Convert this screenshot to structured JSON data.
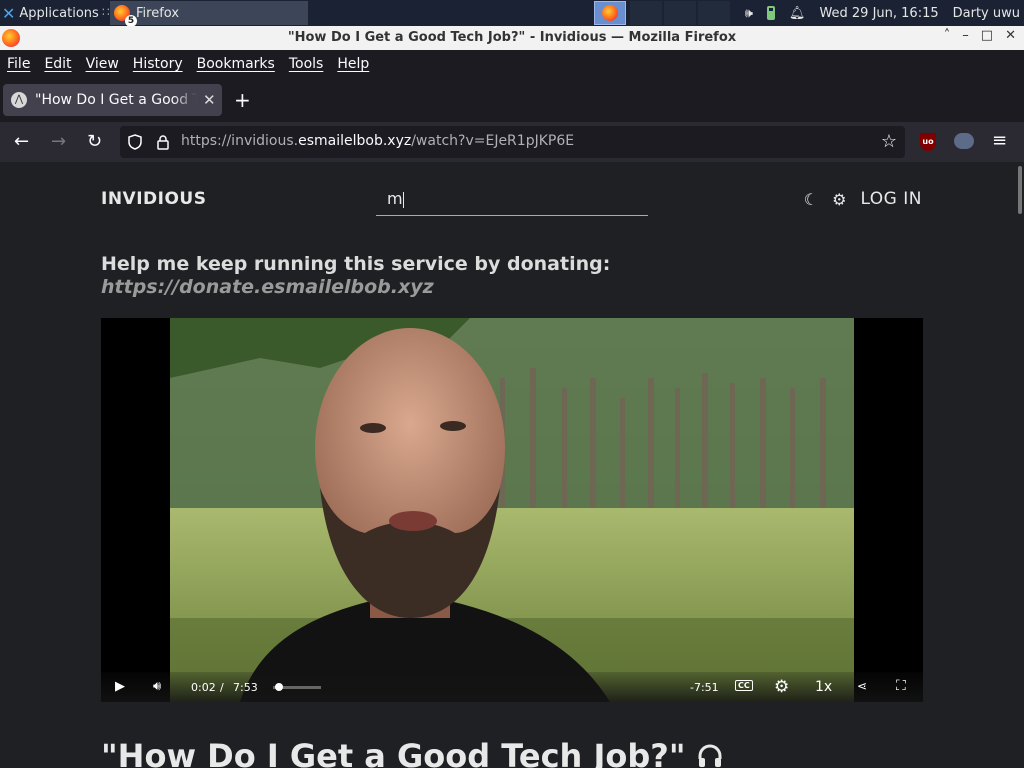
{
  "panel": {
    "applications_label": "Applications",
    "separator": "∷",
    "task_label": "Firefox",
    "task_badge": "5",
    "datetime": "Wed 29 Jun, 16:15",
    "user": "Darty uwu",
    "volume_icon": "volume-icon",
    "battery_icon": "battery-icon",
    "bell_icon": "bell-icon"
  },
  "window": {
    "title": "\"How Do I Get a Good Tech Job?\" - Invidious — Mozilla Firefox",
    "controls": [
      "˄",
      "–",
      "□",
      "✕"
    ]
  },
  "menubar": {
    "items": [
      "File",
      "Edit",
      "View",
      "History",
      "Bookmarks",
      "Tools",
      "Help"
    ]
  },
  "tab": {
    "title": "\"How Do I Get a Good Tech Job?\" - Invidious",
    "close": "✕",
    "new_tab": "+"
  },
  "nav": {
    "back": "←",
    "forward": "→",
    "reload": "↻",
    "url_prefix": "https://invidious.",
    "url_domain": "esmailelbob.xyz",
    "url_path": "/watch?v=EJeR1pJKP6E",
    "ublock_label": "uo",
    "menu": "≡"
  },
  "site": {
    "brand": "INVIDIOUS",
    "search_value": "m",
    "theme_icon": "☾",
    "settings_icon": "⚙",
    "login": "LOG IN",
    "donate_text": "Help me keep running this service by donating:",
    "donate_link": "https://donate.esmailelbob.xyz"
  },
  "player": {
    "current_time": "0:02",
    "time_sep": "/",
    "duration": "7:53",
    "remaining": "-7:51",
    "speed": "1x",
    "progress_fraction": 0.004,
    "buffered_fraction": 0.12
  },
  "video": {
    "title": "\"How Do I Get a Good Tech Job?\"",
    "audio_icon": "headphones-icon"
  },
  "colors": {
    "accent": "#d2a45d",
    "page_bg": "#1f2024",
    "chrome_bg": "#2b2a33"
  }
}
